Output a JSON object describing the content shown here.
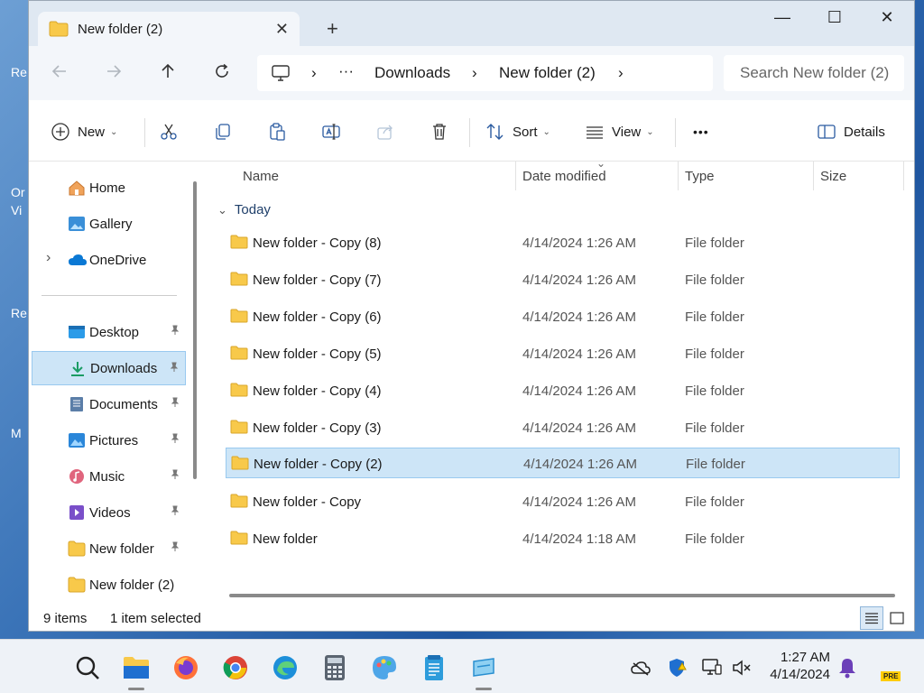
{
  "window": {
    "tab_title": "New folder (2)",
    "close_tab": "✕",
    "add_tab": "+",
    "minimize": "—",
    "maximize": "☐",
    "close": "✕"
  },
  "address": {
    "more": "···",
    "crumbs": [
      "Downloads",
      "New folder (2)"
    ],
    "chevron": "›"
  },
  "search": {
    "placeholder": "Search New folder (2)"
  },
  "toolbar": {
    "new_label": "New",
    "sort_label": "Sort",
    "view_label": "View",
    "more": "•••",
    "details_label": "Details",
    "caret": "⌄"
  },
  "sidebar": {
    "items": [
      {
        "label": "Home"
      },
      {
        "label": "Gallery"
      },
      {
        "label": "OneDrive"
      },
      {
        "label": "Desktop"
      },
      {
        "label": "Downloads"
      },
      {
        "label": "Documents"
      },
      {
        "label": "Pictures"
      },
      {
        "label": "Music"
      },
      {
        "label": "Videos"
      },
      {
        "label": "New folder"
      },
      {
        "label": "New folder (2)"
      }
    ],
    "expand_chevron": "›",
    "pin": "📌"
  },
  "columns": {
    "name": "Name",
    "date": "Date modified",
    "type": "Type",
    "size": "Size",
    "sort_caret": "⌄"
  },
  "group": {
    "label": "Today",
    "chevron": "⌄"
  },
  "files": [
    {
      "name": "New folder - Copy (8)",
      "date": "4/14/2024 1:26 AM",
      "type": "File folder"
    },
    {
      "name": "New folder - Copy (7)",
      "date": "4/14/2024 1:26 AM",
      "type": "File folder"
    },
    {
      "name": "New folder - Copy (6)",
      "date": "4/14/2024 1:26 AM",
      "type": "File folder"
    },
    {
      "name": "New folder - Copy (5)",
      "date": "4/14/2024 1:26 AM",
      "type": "File folder"
    },
    {
      "name": "New folder - Copy (4)",
      "date": "4/14/2024 1:26 AM",
      "type": "File folder"
    },
    {
      "name": "New folder - Copy (3)",
      "date": "4/14/2024 1:26 AM",
      "type": "File folder"
    },
    {
      "name": "New folder - Copy (2)",
      "date": "4/14/2024 1:26 AM",
      "type": "File folder"
    },
    {
      "name": "New folder - Copy",
      "date": "4/14/2024 1:26 AM",
      "type": "File folder"
    },
    {
      "name": "New folder",
      "date": "4/14/2024 1:18 AM",
      "type": "File folder"
    }
  ],
  "status": {
    "count": "9 items",
    "selected": "1 item selected"
  },
  "taskbar": {
    "time": "1:27 AM",
    "date": "4/14/2024",
    "pre_badge": "PRE"
  },
  "desktop_fragments": [
    "Re",
    "Or",
    "Vi",
    "Re",
    "M"
  ],
  "colors": {
    "accent": "#0067c0",
    "selection": "#cde5f7",
    "folder": "#f8c94a"
  }
}
